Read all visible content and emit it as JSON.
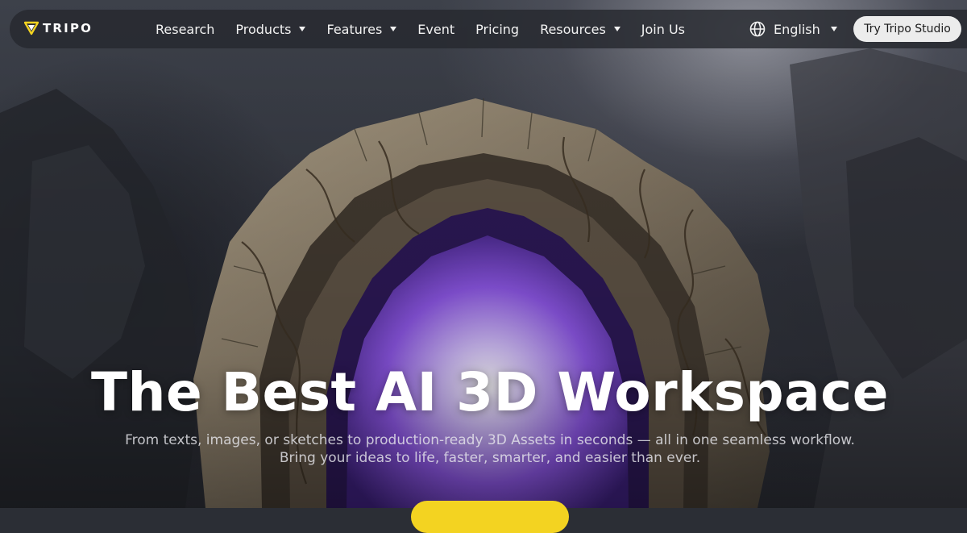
{
  "brand": {
    "name": "TRIPO",
    "logo_icon": "tripo-v-logo-icon",
    "accent": "#f3d321"
  },
  "nav": {
    "items": [
      {
        "label": "Research",
        "has_dropdown": false
      },
      {
        "label": "Products",
        "has_dropdown": true
      },
      {
        "label": "Features",
        "has_dropdown": true
      },
      {
        "label": "Event",
        "has_dropdown": false
      },
      {
        "label": "Pricing",
        "has_dropdown": false
      },
      {
        "label": "Resources",
        "has_dropdown": true
      },
      {
        "label": "Join Us",
        "has_dropdown": false
      }
    ],
    "language": {
      "label": "English",
      "icon": "globe-icon"
    },
    "cta_label": "Try Tripo Studio"
  },
  "hero": {
    "title": "The Best AI 3D Workspace",
    "subtitle_line1": "From texts, images, or sketches to production-ready 3D Assets in seconds — all in one seamless workflow.",
    "subtitle_line2": "Bring your ideas to life, faster, smarter, and easier than ever.",
    "cta_color": "#f3d321"
  }
}
